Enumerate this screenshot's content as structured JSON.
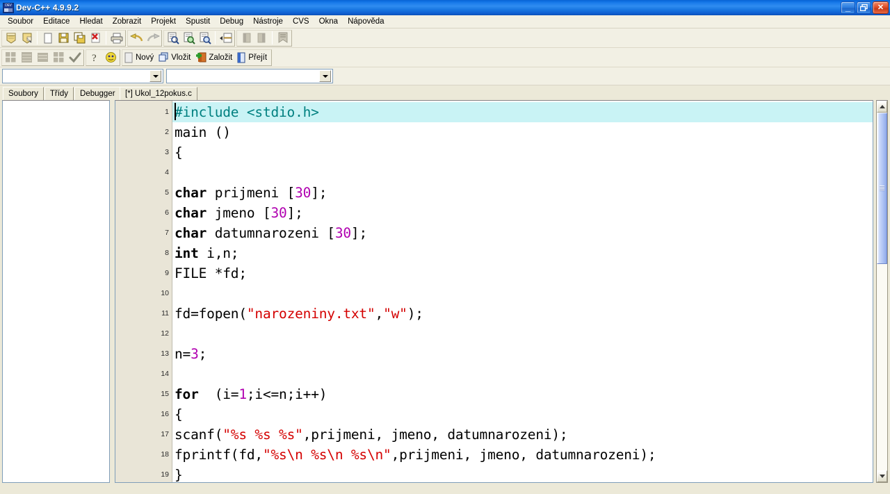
{
  "window": {
    "title": "Dev-C++ 4.9.9.2",
    "app_icon": "dev-cpp-icon",
    "buttons": {
      "minimize": "_",
      "restore": "❐",
      "close": "✕"
    }
  },
  "menubar": {
    "items": [
      {
        "label": "Soubor",
        "name": "menu-soubor"
      },
      {
        "label": "Editace",
        "name": "menu-editace"
      },
      {
        "label": "Hledat",
        "name": "menu-hledat"
      },
      {
        "label": "Zobrazit",
        "name": "menu-zobrazit"
      },
      {
        "label": "Projekt",
        "name": "menu-projekt"
      },
      {
        "label": "Spustit",
        "name": "menu-spustit"
      },
      {
        "label": "Debug",
        "name": "menu-debug"
      },
      {
        "label": "Nástroje",
        "name": "menu-nastroje"
      },
      {
        "label": "CVS",
        "name": "menu-cvs"
      },
      {
        "label": "Okna",
        "name": "menu-okna"
      },
      {
        "label": "Nápověda",
        "name": "menu-napoveda"
      }
    ]
  },
  "toolbar1": {
    "buttons": [
      {
        "icon": "new-project-icon"
      },
      {
        "icon": "open-project-icon"
      },
      {
        "icon": "new-file-icon"
      },
      {
        "icon": "save-icon"
      },
      {
        "icon": "save-all-icon"
      },
      {
        "icon": "close-file-icon"
      },
      {
        "icon": "print-icon"
      },
      {
        "icon": "undo-icon"
      },
      {
        "icon": "redo-icon"
      },
      {
        "icon": "find-icon"
      },
      {
        "icon": "find-next-icon"
      },
      {
        "icon": "replace-icon"
      },
      {
        "icon": "goto-line-icon"
      },
      {
        "icon": "prev-bookmark-icon"
      },
      {
        "icon": "next-bookmark-icon"
      },
      {
        "icon": "toggle-bookmark-icon"
      }
    ]
  },
  "toolbar2": {
    "buttons": [
      {
        "icon": "compile-icon"
      },
      {
        "icon": "run-icon"
      },
      {
        "icon": "compile-run-icon"
      },
      {
        "icon": "rebuild-all-icon"
      },
      {
        "icon": "syntax-check-icon"
      },
      {
        "icon": "help-icon"
      },
      {
        "icon": "about-icon"
      }
    ],
    "labeled": [
      {
        "label": "Nový",
        "icon": "cvs-new-icon",
        "name": "cvs-novy-button"
      },
      {
        "label": "Vložit",
        "icon": "cvs-import-icon",
        "name": "cvs-vlozit-button"
      },
      {
        "label": "Založit",
        "icon": "cvs-add-icon",
        "name": "cvs-zalozit-button"
      },
      {
        "label": "Přejít",
        "icon": "cvs-goto-icon",
        "name": "cvs-prejit-button"
      }
    ]
  },
  "combos": {
    "left": {
      "value": "",
      "placeholder": ""
    },
    "right": {
      "value": "",
      "placeholder": ""
    }
  },
  "panel_tabs": {
    "items": [
      {
        "label": "Soubory",
        "name": "tab-soubory",
        "active": true
      },
      {
        "label": "Třídy",
        "name": "tab-tridy",
        "active": false
      },
      {
        "label": "Debugger",
        "name": "tab-debugger",
        "active": false
      }
    ]
  },
  "editor_tabs": {
    "items": [
      {
        "label": "[*] Ukol_12pokus.c",
        "name": "editor-tab-ukol12pokus",
        "active": true
      }
    ]
  },
  "editor": {
    "active_line": 1,
    "line_count": 19,
    "colors": {
      "preprocessor": "#008080",
      "string": "#d40000",
      "number": "#b000b0",
      "keyword": "#000000",
      "active_line_bg": "#c9f3f5",
      "gutter_bg": "#e9e5d7",
      "code_bg": "#ffffff"
    },
    "lines": [
      {
        "n": "1",
        "tokens": [
          {
            "t": "#include <stdio.h>",
            "c": "pre"
          }
        ]
      },
      {
        "n": "2",
        "tokens": [
          {
            "t": "main ()",
            "c": ""
          }
        ]
      },
      {
        "n": "3",
        "tokens": [
          {
            "t": "{",
            "c": ""
          }
        ]
      },
      {
        "n": "4",
        "tokens": []
      },
      {
        "n": "5",
        "tokens": [
          {
            "t": "char",
            "c": "kw"
          },
          {
            "t": " prijmeni [",
            "c": ""
          },
          {
            "t": "30",
            "c": "num"
          },
          {
            "t": "];",
            "c": ""
          }
        ]
      },
      {
        "n": "6",
        "tokens": [
          {
            "t": "char",
            "c": "kw"
          },
          {
            "t": " jmeno [",
            "c": ""
          },
          {
            "t": "30",
            "c": "num"
          },
          {
            "t": "];",
            "c": ""
          }
        ]
      },
      {
        "n": "7",
        "tokens": [
          {
            "t": "char",
            "c": "kw"
          },
          {
            "t": " datumnarozeni [",
            "c": ""
          },
          {
            "t": "30",
            "c": "num"
          },
          {
            "t": "];",
            "c": ""
          }
        ]
      },
      {
        "n": "8",
        "tokens": [
          {
            "t": "int",
            "c": "kw"
          },
          {
            "t": " i,n;",
            "c": ""
          }
        ]
      },
      {
        "n": "9",
        "tokens": [
          {
            "t": "FILE *fd;",
            "c": ""
          }
        ]
      },
      {
        "n": "10",
        "tokens": []
      },
      {
        "n": "11",
        "tokens": [
          {
            "t": "fd=fopen(",
            "c": ""
          },
          {
            "t": "\"narozeniny.txt\"",
            "c": "str"
          },
          {
            "t": ",",
            "c": ""
          },
          {
            "t": "\"w\"",
            "c": "str"
          },
          {
            "t": ");",
            "c": ""
          }
        ]
      },
      {
        "n": "12",
        "tokens": []
      },
      {
        "n": "13",
        "tokens": [
          {
            "t": "n=",
            "c": ""
          },
          {
            "t": "3",
            "c": "num"
          },
          {
            "t": ";",
            "c": ""
          }
        ]
      },
      {
        "n": "14",
        "tokens": []
      },
      {
        "n": "15",
        "tokens": [
          {
            "t": "for",
            "c": "kw"
          },
          {
            "t": "  (i=",
            "c": ""
          },
          {
            "t": "1",
            "c": "num"
          },
          {
            "t": ";i<=n;i++)",
            "c": ""
          }
        ]
      },
      {
        "n": "16",
        "tokens": [
          {
            "t": "{",
            "c": ""
          }
        ]
      },
      {
        "n": "17",
        "tokens": [
          {
            "t": "scanf(",
            "c": ""
          },
          {
            "t": "\"%s %s %s\"",
            "c": "str"
          },
          {
            "t": ",prijmeni, jmeno, datumnarozeni);",
            "c": ""
          }
        ]
      },
      {
        "n": "18",
        "tokens": [
          {
            "t": "fprintf(fd,",
            "c": ""
          },
          {
            "t": "\"%s\\n %s\\n %s\\n\"",
            "c": "str"
          },
          {
            "t": ",prijmeni, jmeno, datumnarozeni);",
            "c": ""
          }
        ]
      },
      {
        "n": "19",
        "tokens": [
          {
            "t": "}",
            "c": ""
          }
        ]
      }
    ]
  },
  "scrollbar": {
    "up_arrow": "▲",
    "down_arrow": "▼",
    "thumb_position": "top"
  }
}
